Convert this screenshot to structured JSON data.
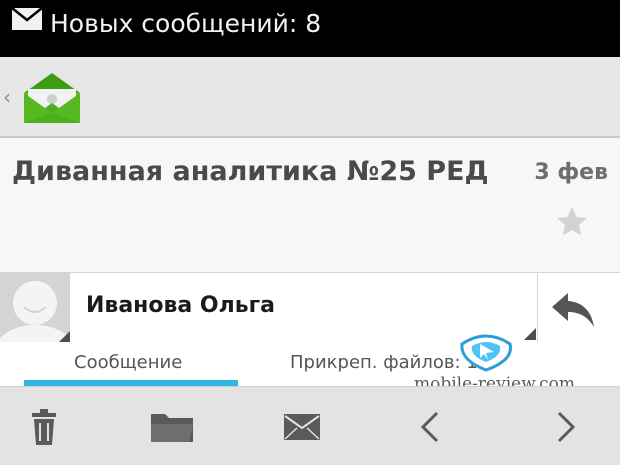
{
  "status_bar": {
    "notification_text": "Новых сообщений: 8",
    "icon": "mail-icon"
  },
  "action_bar": {
    "up_icon": "chevron-left-icon",
    "app_icon": "email-app-icon"
  },
  "message": {
    "subject": "Диванная аналитика №25 РЕД",
    "date": "3 фев",
    "starred": false,
    "sender": {
      "name": "Иванова Ольга",
      "avatar": "default-avatar-icon"
    }
  },
  "tabs": [
    {
      "label": "Сообщение",
      "selected": true
    },
    {
      "label": "Прикреп. файлов: 1",
      "selected": false
    }
  ],
  "watermark": {
    "text": "mobile-review.com"
  },
  "bottom_bar": {
    "actions": [
      "delete-icon",
      "folder-icon",
      "mark-unread-icon",
      "previous-icon",
      "next-icon"
    ]
  },
  "colors": {
    "status_bar_bg": "#000000",
    "action_bar_bg": "#e7e7e7",
    "tab_indicator": "#33b5e5",
    "bottom_bar_bg": "#e3e3e3",
    "app_icon_green": "#4caf1c"
  }
}
